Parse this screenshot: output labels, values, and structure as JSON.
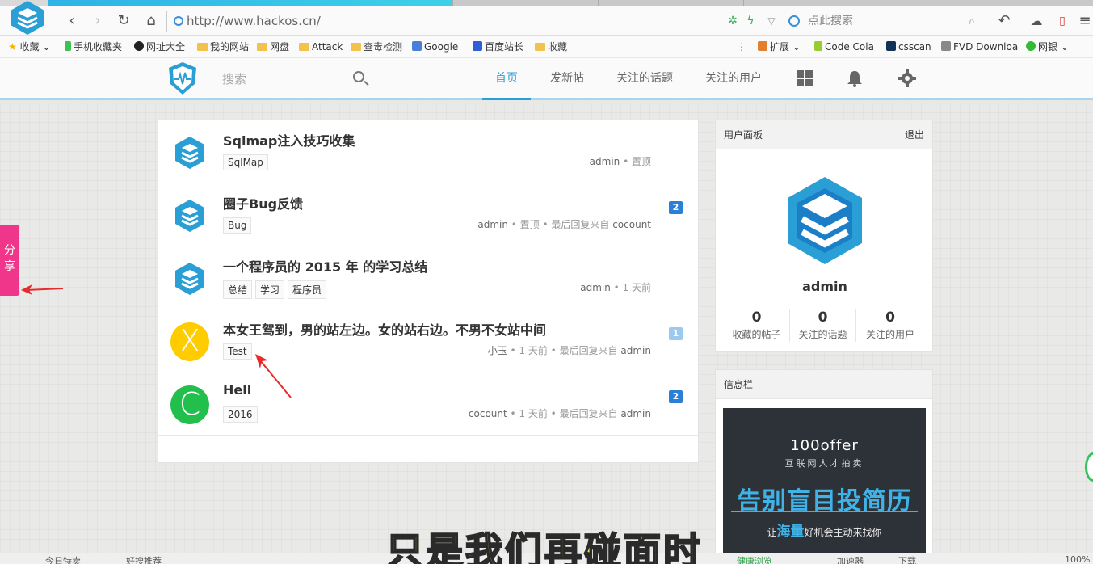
{
  "browser": {
    "url": "http://www.hackos.cn/",
    "search_placeholder": "点此搜索",
    "bookmarks_left": [
      "收藏",
      "手机收藏夹",
      "网址大全",
      "我的网站",
      "网盘",
      "Attack",
      "查毒检测",
      "Google",
      "百度站长",
      "收藏"
    ],
    "bookmarks_right": [
      "扩展",
      "Code Cola",
      "csscan",
      "FVD Downloa",
      "网银"
    ]
  },
  "site": {
    "search_placeholder": "搜索",
    "nav": [
      "首页",
      "发新帖",
      "关注的话题",
      "关注的用户"
    ],
    "active_nav": "首页"
  },
  "topics": [
    {
      "title": "Sqlmap注入技巧收集",
      "tags": [
        "SqlMap"
      ],
      "author": "admin",
      "meta": " • 置顶",
      "last_reply": "",
      "reply_count": "",
      "avatar": "logo"
    },
    {
      "title": "圈子Bug反馈",
      "tags": [
        "Bug"
      ],
      "author": "admin",
      "meta": " • 置顶 • 最后回复来自 ",
      "last_reply": "cocount",
      "reply_count": "2",
      "avatar": "logo"
    },
    {
      "title": "一个程序员的 2015 年 的学习总结",
      "tags": [
        "总结",
        "学习",
        "程序员"
      ],
      "author": "admin",
      "meta": " • 1 天前",
      "last_reply": "",
      "reply_count": "",
      "avatar": "logo"
    },
    {
      "title": "本女王驾到，男的站左边。女的站右边。不男不女站中间",
      "tags": [
        "Test"
      ],
      "author": "小玉",
      "meta": " • 1 天前 • 最后回复来自 ",
      "last_reply": "admin",
      "reply_count": "1",
      "avatar": "X"
    },
    {
      "title": "Hell",
      "tags": [
        "2016"
      ],
      "author": "cocount",
      "meta": " • 1 天前 • 最后回复来自 ",
      "last_reply": "admin",
      "reply_count": "2",
      "avatar": "C"
    }
  ],
  "user_panel": {
    "title": "用户面板",
    "logout": "退出",
    "username": "admin",
    "stats": [
      {
        "value": "0",
        "label": "收藏的帖子"
      },
      {
        "value": "0",
        "label": "关注的话题"
      },
      {
        "value": "0",
        "label": "关注的用户"
      }
    ]
  },
  "info_panel": {
    "title": "信息栏",
    "ad": {
      "brand": "100offer",
      "sub": "互联网人才拍卖",
      "headline": "告别盲目投简历",
      "tag_pre": "让",
      "tag_em": "海量",
      "tag_post": "好机会主动来找你"
    }
  },
  "share": {
    "label_1": "分",
    "label_2": "享"
  },
  "status_bar": [
    "今日特卖",
    "好搜推荐",
    "健康浏览",
    "加速器",
    "下载",
    "100%"
  ],
  "subtitle": "只是我们再碰面时",
  "colors": {
    "accent": "#2a9fd6",
    "share": "#f0368a",
    "badge": "#2a7fd6",
    "avatar_x": "#ffcc00",
    "avatar_c": "#22bf4d"
  }
}
